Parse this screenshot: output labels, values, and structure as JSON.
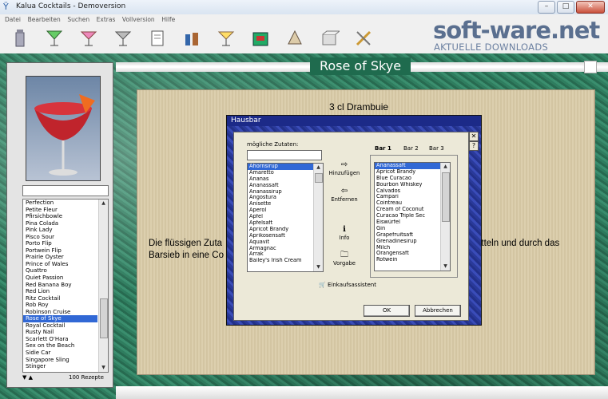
{
  "window": {
    "title": "Kalua Cocktails - Demoversion"
  },
  "menu": [
    "Datei",
    "Bearbeiten",
    "Suchen",
    "Extras",
    "Vollversion",
    "Hilfe"
  ],
  "toolbar_icons": [
    "shaker-icon",
    "glass-icon",
    "cocktail-icon",
    "cocktail2-icon",
    "recipe-icon",
    "bottles-icon",
    "bar-glass-icon",
    "register-icon",
    "shopping-icon",
    "box-icon",
    "tools-icon"
  ],
  "logo": {
    "big": "soft-ware.net",
    "small": "AKTUELLE DOWNLOADS"
  },
  "recipe": {
    "name": "Rose of Skye",
    "ingredient_line": "3 cl  Drambuie",
    "text_left_1": "Die flüssigen Zuta",
    "text_left_2": "Barsieb in eine Co",
    "text_right": "ütteln und durch das"
  },
  "left": {
    "count": "100 Rezepte",
    "cocktails": [
      "Perfection",
      "Petite Fleur",
      "Pfirsichbowle",
      "Pina Colada",
      "Pink Lady",
      "Pisco Sour",
      "Porto Flip",
      "Portwein Flip",
      "Prairie Oyster",
      "Prince of Wales",
      "Quattro",
      "Quiet Passion",
      "Red Banana Boy",
      "Red Lion",
      "Ritz Cocktail",
      "Rob Roy",
      "Robinson Cruise",
      "Rose of Skye",
      "Royal Cocktail",
      "Rusty Nail",
      "Scarlett O'Hara",
      "Sex on the Beach",
      "Sidie Car",
      "Singapore Sling",
      "Stinger"
    ],
    "selected": "Rose of Skye"
  },
  "dialog": {
    "title": "Hausbar",
    "label_zutaten": "mögliche Zutaten:",
    "zutaten": [
      "Ahornsirup",
      "Amaretto",
      "Ananas",
      "Ananassaft",
      "Ananassirup",
      "Angostura",
      "Anisette",
      "Aperol",
      "Apfel",
      "Apfelsaft",
      "Apricot Brandy",
      "Aprikosensaft",
      "Aquavit",
      "Armagnac",
      "Arrak",
      "Bailey's Irish Cream"
    ],
    "zutaten_selected": "Ahornsirup",
    "btn_hinzufuegen": "Hinzufügen",
    "btn_entfernen": "Entfernen",
    "btn_info": "Info",
    "btn_vorgabe": "Vorgabe",
    "tabs": [
      "Bar 1",
      "Bar 2",
      "Bar 3"
    ],
    "bar_items": [
      "Ananassaft",
      "Apricot Brandy",
      "Blue Curacao",
      "Bourbon Whiskey",
      "Calvados",
      "Campari",
      "Cointreau",
      "Cream of Coconut",
      "Curacao Triple Sec",
      "Eiswürfel",
      "Gin",
      "Grapefruitsaft",
      "Grenadinesirup",
      "Milch",
      "Orangensaft",
      "Rotwein"
    ],
    "bar_selected": "Ananassaft",
    "einkauf": "Einkaufsassistent",
    "ok": "OK",
    "cancel": "Abbrechen",
    "close_glyph": "✕",
    "help_glyph": "?"
  }
}
